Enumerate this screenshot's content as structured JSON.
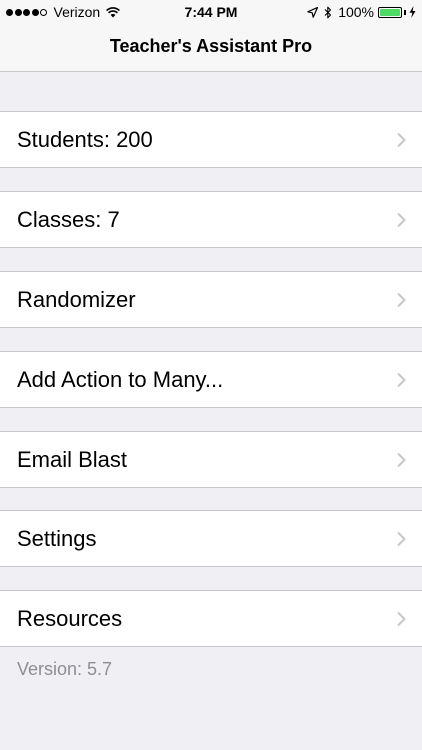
{
  "status_bar": {
    "carrier": "Verizon",
    "time": "7:44 PM",
    "battery_percent": "100%",
    "battery_level": 1.0,
    "signal_bars_filled": 4,
    "signal_bars_total": 5
  },
  "nav": {
    "title": "Teacher's Assistant Pro"
  },
  "menu": {
    "items": [
      {
        "label": "Students: 200"
      },
      {
        "label": "Classes: 7"
      },
      {
        "label": "Randomizer"
      },
      {
        "label": "Add Action to Many..."
      },
      {
        "label": "Email Blast"
      },
      {
        "label": "Settings"
      },
      {
        "label": "Resources"
      }
    ]
  },
  "footer": {
    "version": "Version: 5.7"
  },
  "colors": {
    "background": "#efeff4",
    "cell": "#ffffff",
    "separator": "#c8c7cc",
    "chevron": "#c7c7cc",
    "secondary_text": "#8e8e93",
    "battery_fill": "#4cd964"
  },
  "icons": {
    "signal": "signal-dots-icon",
    "wifi": "wifi-icon",
    "location": "location-arrow-icon",
    "bluetooth": "bluetooth-icon",
    "battery": "battery-icon",
    "charging": "charging-bolt-icon",
    "disclosure": "chevron-right-icon"
  }
}
